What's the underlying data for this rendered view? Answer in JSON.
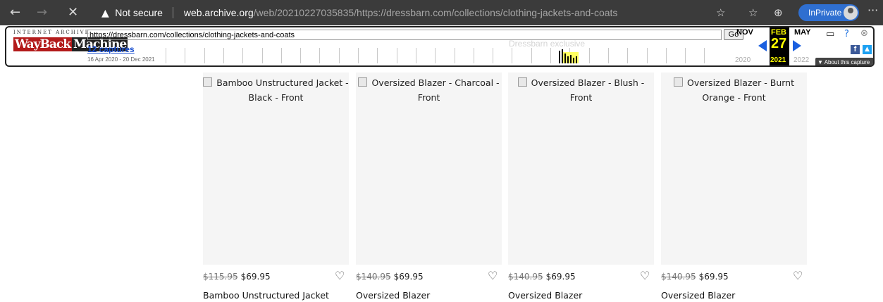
{
  "browser": {
    "security_label": "Not secure",
    "url_host": "web.archive.org",
    "url_path": "/web/20210227035835/https://dressbarn.com/collections/clothing-jackets-and-coats",
    "inprivate_label": "InPrivate"
  },
  "wayback": {
    "ia_label": "INTERNET ARCHIVE",
    "logo_part1": "WayBack",
    "logo_part2": "Machine",
    "url_value": "https://dressbarn.com/collections/clothing-jackets-and-coats",
    "go_label": "Go",
    "captures_label": "12 captures",
    "captures_range": "16 Apr 2020 - 20 Dec 2021",
    "ghost_text": "Dressbarn exclusive",
    "prev_month": "NOV",
    "cur_month": "FEB",
    "next_month": "MAY",
    "cur_day": "27",
    "prev_year": "2020",
    "cur_year": "2021",
    "next_year": "2022",
    "about_label": "▼ About this capture"
  },
  "products": [
    {
      "alt": "Bamboo Unstructured Jacket - Black - Front",
      "orig_price": "$115.95",
      "price": "$69.95",
      "name": "Bamboo Unstructured Jacket"
    },
    {
      "alt": "Oversized Blazer - Charcoal - Front",
      "orig_price": "$140.95",
      "price": "$69.95",
      "name": "Oversized Blazer"
    },
    {
      "alt": "Oversized Blazer - Blush - Front",
      "orig_price": "$140.95",
      "price": "$69.95",
      "name": "Oversized Blazer"
    },
    {
      "alt": "Oversized Blazer - Burnt Orange - Front",
      "orig_price": "$140.95",
      "price": "$69.95",
      "name": "Oversized Blazer"
    }
  ]
}
